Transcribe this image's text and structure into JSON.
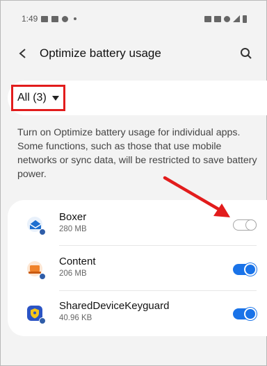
{
  "status_bar": {
    "time": "1:49"
  },
  "app_bar": {
    "title": "Optimize battery usage",
    "back_icon": "back-icon",
    "search_icon": "search-icon"
  },
  "filter": {
    "label": "All (3)"
  },
  "description": "Turn on Optimize battery usage for individual apps. Some functions, such as those that use mobile networks or sync data, will be restricted to save battery power.",
  "apps": [
    {
      "name": "Boxer",
      "size": "280 MB",
      "optimized": false,
      "icon_color": "#1e6fd0"
    },
    {
      "name": "Content",
      "size": "206 MB",
      "optimized": true,
      "icon_color": "#f0822a"
    },
    {
      "name": "SharedDeviceKeyguard",
      "size": "40.96 KB",
      "optimized": true,
      "icon_color": "#2b54c4"
    }
  ],
  "colors": {
    "accent": "#1a73e8",
    "highlight": "#e21c1c",
    "background": "#f3f3f3"
  }
}
